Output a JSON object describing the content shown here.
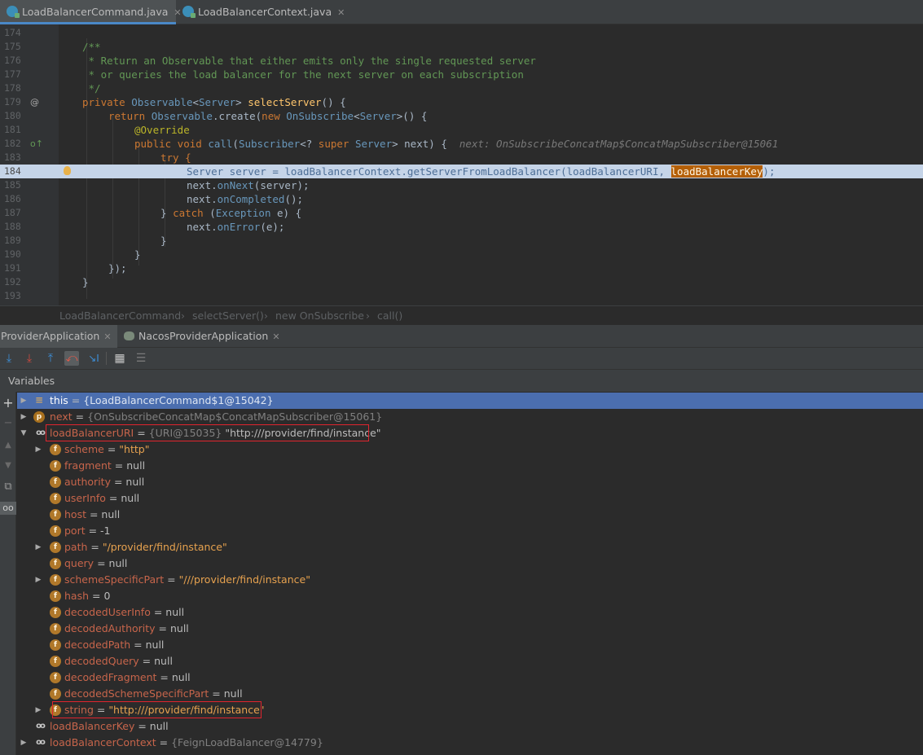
{
  "editor_tabs": [
    {
      "label": "LoadBalancerCommand.java"
    },
    {
      "label": "LoadBalancerContext.java"
    }
  ],
  "code_lines": [
    {
      "num": "174"
    },
    {
      "num": "175"
    },
    {
      "num": "176"
    },
    {
      "num": "177"
    },
    {
      "num": "178"
    },
    {
      "num": "179"
    },
    {
      "num": "180"
    },
    {
      "num": "181"
    },
    {
      "num": "182"
    },
    {
      "num": "183"
    },
    {
      "num": "184"
    },
    {
      "num": "185"
    },
    {
      "num": "186"
    },
    {
      "num": "187"
    },
    {
      "num": "188"
    },
    {
      "num": "189"
    },
    {
      "num": "190"
    },
    {
      "num": "191"
    },
    {
      "num": "192"
    },
    {
      "num": "193"
    }
  ],
  "code": {
    "l175": "/**",
    "l176": " * Return an Observable that either emits only the single requested server",
    "l177": " * or queries the load balancer for the next server on each subscription",
    "l178": " */",
    "l179_kw": "private ",
    "l179_ty1": "Observable",
    "l179_p1": "<",
    "l179_ty2": "Server",
    "l179_p2": "> ",
    "l179_fn": "selectServer",
    "l179_p3": "() {",
    "l180_kw": "return ",
    "l180_ty": "Observable",
    "l180_p1": ".create(",
    "l180_kw2": "new ",
    "l180_ty2": "OnSubscribe",
    "l180_p2": "<",
    "l180_ty3": "Server",
    "l180_p3": ">() {",
    "l181": "@Override",
    "l182_kw": "public void ",
    "l182_fn": "call",
    "l182_p1": "(",
    "l182_ty": "Subscriber",
    "l182_p2": "<? ",
    "l182_kw2": "super ",
    "l182_ty2": "Server",
    "l182_p3": "> next) {  ",
    "l182_hint": "next: OnSubscribeConcatMap$ConcatMapSubscriber@15061",
    "l183": "try {",
    "l184_a": "Server server = loadBalancerContext.getServerFromLoadBalancer(loadBalancerURI, ",
    "l184_sel": "loadBalancerKey",
    "l184_b": ");",
    "l185_a": "next.",
    "l185_m": "onNext",
    "l185_b": "(server);",
    "l186_a": "next.",
    "l186_m": "onCompleted",
    "l186_b": "();",
    "l187_a": "} ",
    "l187_kw": "catch ",
    "l187_b": "(",
    "l187_ty": "Exception",
    "l187_c": " e) {",
    "l188_a": "next.",
    "l188_m": "onError",
    "l188_b": "(e);",
    "l189": "}",
    "l190": "}",
    "l191": "});",
    "l192": "}"
  },
  "breadcrumb": [
    "LoadBalancerCommand",
    "selectServer()",
    "new OnSubscribe",
    "call()"
  ],
  "debug_tabs": [
    {
      "label": "ProviderApplication"
    },
    {
      "label": "NacosProviderApplication"
    }
  ],
  "panel_title": "Variables",
  "variables": [
    {
      "name": "this",
      "eq": " = ",
      "value": "{LoadBalancerCommand$1@15042}",
      "kind": "ref",
      "icon": "list",
      "selected": true
    },
    {
      "name": "next",
      "eq": " = ",
      "value": "{OnSubscribeConcatMap$ConcatMapSubscriber@15061}",
      "kind": "ref",
      "icon": "p"
    },
    {
      "name": "loadBalancerURI",
      "eq": " = ",
      "value": "{URI@15035}",
      "value2": " \"http:///provider/find/instance\"",
      "kind": "ref",
      "icon": "glass",
      "expanded": true,
      "highlighted": true
    },
    {
      "name": "scheme",
      "eq": " = ",
      "value": "\"http\"",
      "kind": "str",
      "icon": "f",
      "child": true,
      "expandable": true
    },
    {
      "name": "fragment",
      "eq": " = ",
      "value": "null",
      "kind": "null",
      "icon": "f",
      "child": true
    },
    {
      "name": "authority",
      "eq": " = ",
      "value": "null",
      "kind": "null",
      "icon": "f",
      "child": true
    },
    {
      "name": "userInfo",
      "eq": " = ",
      "value": "null",
      "kind": "null",
      "icon": "f",
      "child": true
    },
    {
      "name": "host",
      "eq": " = ",
      "value": "null",
      "kind": "null",
      "icon": "f",
      "child": true
    },
    {
      "name": "port",
      "eq": " = ",
      "value": "-1",
      "kind": "null",
      "icon": "f",
      "child": true
    },
    {
      "name": "path",
      "eq": " = ",
      "value": "\"/provider/find/instance\"",
      "kind": "str",
      "icon": "f",
      "child": true,
      "expandable": true
    },
    {
      "name": "query",
      "eq": " = ",
      "value": "null",
      "kind": "null",
      "icon": "f",
      "child": true
    },
    {
      "name": "schemeSpecificPart",
      "eq": " = ",
      "value": "\"///provider/find/instance\"",
      "kind": "str",
      "icon": "f",
      "child": true,
      "expandable": true
    },
    {
      "name": "hash",
      "eq": " = ",
      "value": "0",
      "kind": "null",
      "icon": "f",
      "child": true
    },
    {
      "name": "decodedUserInfo",
      "eq": " = ",
      "value": "null",
      "kind": "null",
      "icon": "f",
      "child": true
    },
    {
      "name": "decodedAuthority",
      "eq": " = ",
      "value": "null",
      "kind": "null",
      "icon": "f",
      "child": true
    },
    {
      "name": "decodedPath",
      "eq": " = ",
      "value": "null",
      "kind": "null",
      "icon": "f",
      "child": true
    },
    {
      "name": "decodedQuery",
      "eq": " = ",
      "value": "null",
      "kind": "null",
      "icon": "f",
      "child": true
    },
    {
      "name": "decodedFragment",
      "eq": " = ",
      "value": "null",
      "kind": "null",
      "icon": "f",
      "child": true
    },
    {
      "name": "decodedSchemeSpecificPart",
      "eq": " = ",
      "value": "null",
      "kind": "null",
      "icon": "f",
      "child": true
    },
    {
      "name": "string",
      "eq": " = ",
      "value": "\"http:///provider/find/instance\"",
      "kind": "str",
      "icon": "f",
      "child": true,
      "expandable": true,
      "highlighted": true
    },
    {
      "name": "loadBalancerKey",
      "eq": " = ",
      "value": "null",
      "kind": "null",
      "icon": "glass"
    },
    {
      "name": "loadBalancerContext",
      "eq": " = ",
      "value": "{FeignLoadBalancer@14779}",
      "kind": "ref",
      "icon": "glass",
      "expandable": true
    }
  ],
  "icons": {
    "debug_toolbar": [
      "step-over-icon",
      "step-into-icon",
      "force-step-into-icon",
      "step-out-icon",
      "drop-frame-icon",
      "run-to-cursor-icon",
      "evaluate-expression-icon",
      "trace-icon"
    ],
    "side_toolbar": [
      "add-watch-icon",
      "remove-watch-icon",
      "move-up-icon",
      "move-down-icon",
      "copy-icon",
      "show-watches-icon"
    ]
  },
  "colors": {
    "execution_line": "#c5d4e8",
    "selection": "#4b6eaf",
    "highlight_box": "#e0242e",
    "active_tab_underline": "#4a88c7"
  }
}
